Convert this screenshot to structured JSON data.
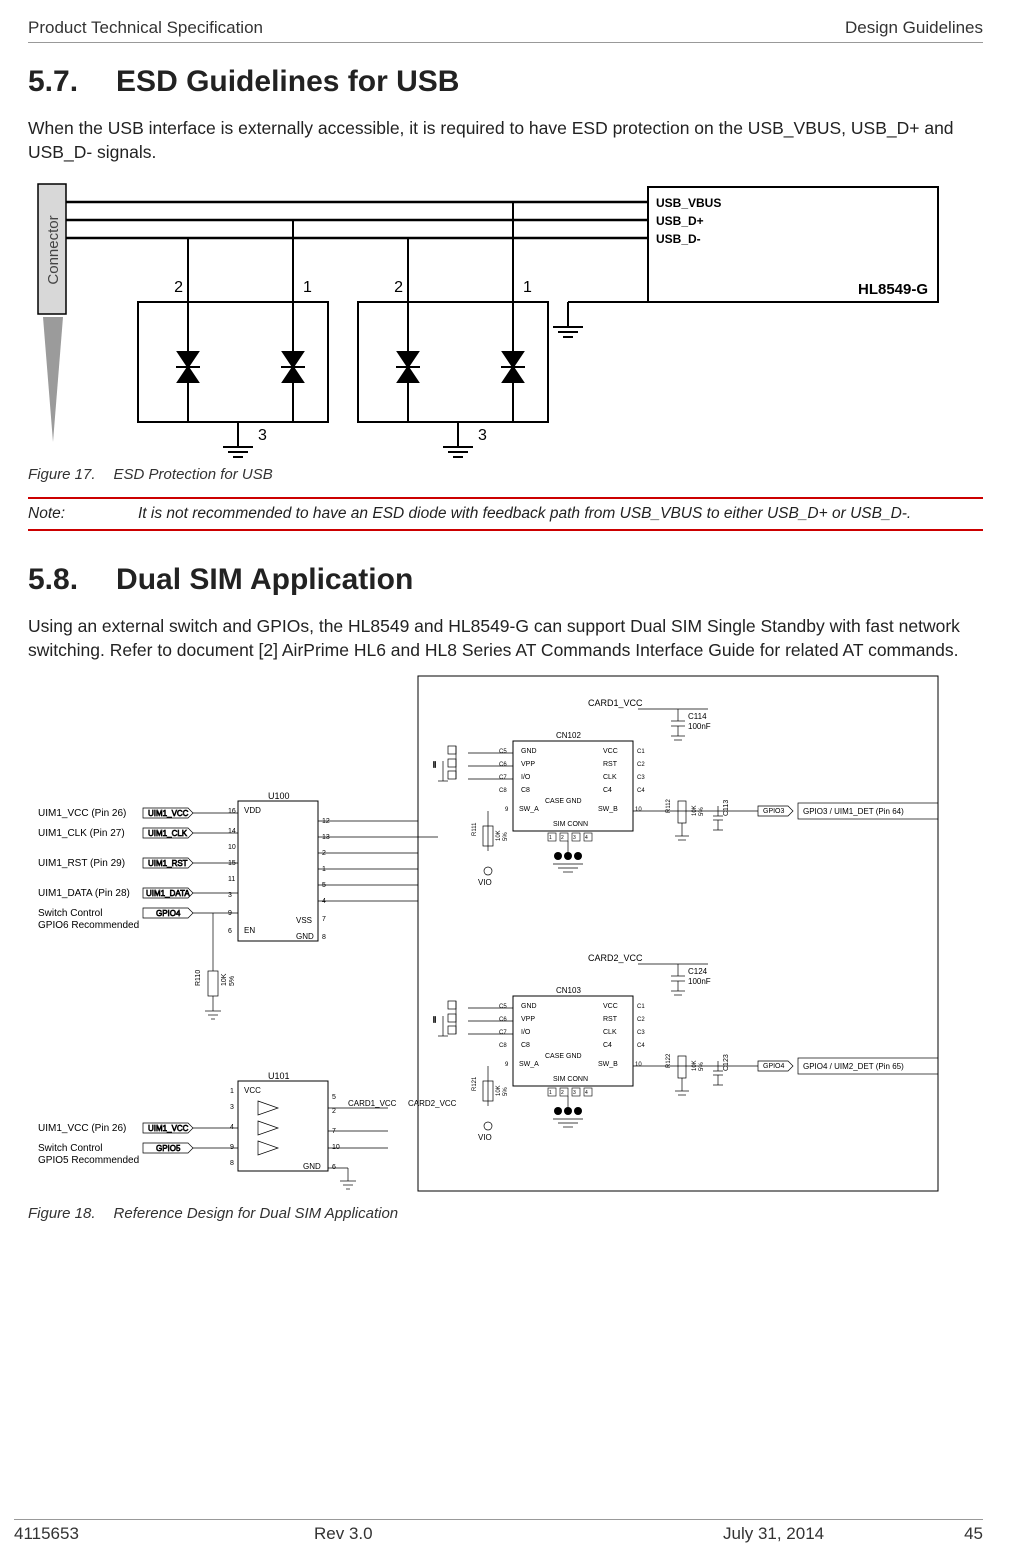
{
  "header": {
    "left": "Product Technical Specification",
    "right": "Design Guidelines"
  },
  "section57": {
    "number": "5.7.",
    "title": "ESD Guidelines for USB",
    "paragraph": "When the USB interface is externally accessible, it is required to have ESD protection on the USB_VBUS, USB_D+ and USB_D- signals."
  },
  "figure17": {
    "number": "Figure 17.",
    "caption": "ESD Protection for USB",
    "labels": {
      "connector": "Connector",
      "usb_vbus": "USB_VBUS",
      "usb_dp": "USB_D+",
      "usb_dm": "USB_D-",
      "module": "HL8549-G",
      "pin1a": "1",
      "pin2a": "2",
      "pin3a": "3",
      "pin1b": "1",
      "pin2b": "2",
      "pin3b": "3"
    }
  },
  "note": {
    "label": "Note:",
    "text": "It is not recommended to have an ESD diode with feedback path from USB_VBUS to either USB_D+ or USB_D-."
  },
  "section58": {
    "number": "5.8.",
    "title": "Dual SIM Application",
    "paragraph": "Using an external switch and GPIOs, the HL8549 and HL8549-G can support Dual SIM Single Standby with fast network switching. Refer to document [2] AirPrime HL6 and HL8 Series AT Commands Interface Guide for related AT commands."
  },
  "figure18": {
    "number": "Figure 18.",
    "caption": "Reference Design for Dual SIM Application",
    "labels": {
      "uim1_vcc_pin": "UIM1_VCC (Pin 26)",
      "uim1_clk_pin": "UIM1_CLK (Pin 27)",
      "uim1_rst_pin": "UIM1_RST (Pin 29)",
      "uim1_data_pin": "UIM1_DATA (Pin 28)",
      "switch_control": "Switch Control",
      "gpio6_rec": "GPIO6 Recommended",
      "gpio5_rec": "GPIO5 Recommended",
      "uim1_vcc": "UIM1_VCC",
      "uim1_clk": "UIM1_CLK",
      "uim1_rst": "UIM1_RST",
      "uim1_data": "UIM1_DATA",
      "gpio4": "GPIO4",
      "gpio5": "GPIO5",
      "gpio3": "GPIO3",
      "u100": "U100",
      "u101": "U101",
      "vdd": "VDD",
      "vcc": "VCC",
      "vss": "VSS",
      "gnd": "GND",
      "en": "EN",
      "card1_vcc": "CARD1_VCC",
      "card2_vcc": "CARD2_VCC",
      "cn102": "CN102",
      "cn103": "CN103",
      "sim_conn": "SIM CONN",
      "case_gnd": "CASE GND",
      "vpp": "VPP",
      "io": "I/O",
      "clk": "CLK",
      "rst": "RST",
      "sw_a": "SW_A",
      "sw_b": "SW_B",
      "vio": "VIO",
      "c114": "C114",
      "c124": "C124",
      "cap_100nf": "100nF",
      "r110": "R110",
      "r111": "R111",
      "r112": "R112",
      "r121": "R121",
      "r122": "R122",
      "val_10k": "10K",
      "val_5pct": "5%",
      "c113": "C113",
      "c123": "C123",
      "gpio3_uim1_det": "GPIO3 / UIM1_DET (Pin 64)",
      "gpio4_uim2_det": "GPIO4 / UIM2_DET (Pin 65)",
      "c1": "C1",
      "c2": "C2",
      "c3": "C3",
      "c4": "C4",
      "c5": "C5",
      "c6": "C6",
      "c7": "C7",
      "c8": "C8"
    }
  },
  "footer": {
    "doc_id": "4115653",
    "rev": "Rev 3.0",
    "date": "July 31, 2014",
    "page": "45"
  }
}
